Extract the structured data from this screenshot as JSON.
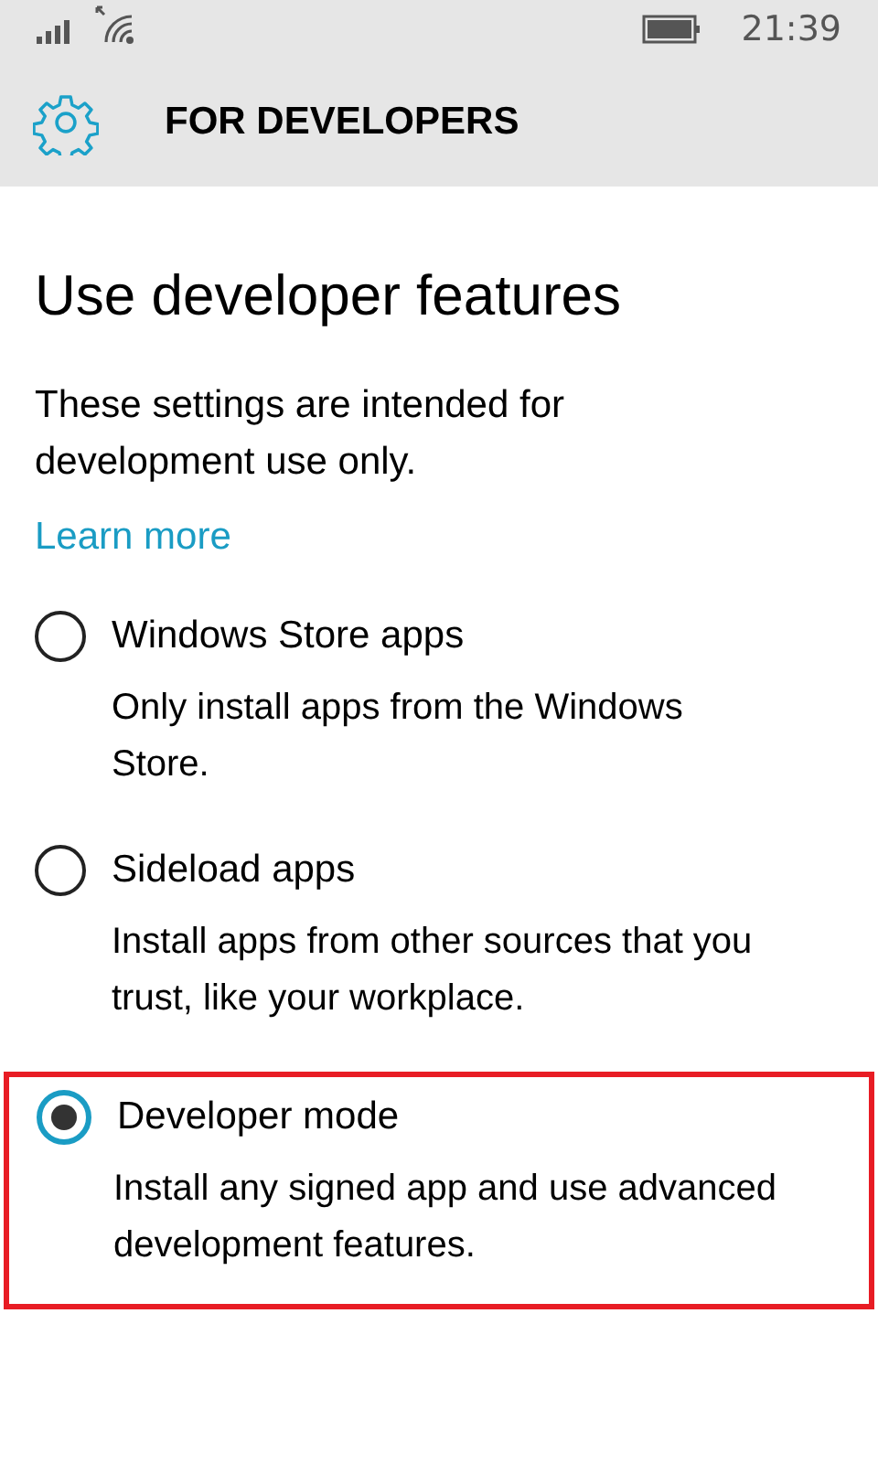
{
  "status_bar": {
    "time": "21:39"
  },
  "header": {
    "title": "FOR DEVELOPERS"
  },
  "heading": "Use developer features",
  "description": "These settings are intended for development use only.",
  "link": "Learn more",
  "options": [
    {
      "label": "Windows Store apps",
      "description": "Only install apps from the Windows Store.",
      "selected": false,
      "highlighted": false
    },
    {
      "label": "Sideload apps",
      "description": "Install apps from other sources that you trust, like your workplace.",
      "selected": false,
      "highlighted": false
    },
    {
      "label": "Developer mode",
      "description": "Install any signed app and use advanced development features.",
      "selected": true,
      "highlighted": true
    }
  ]
}
